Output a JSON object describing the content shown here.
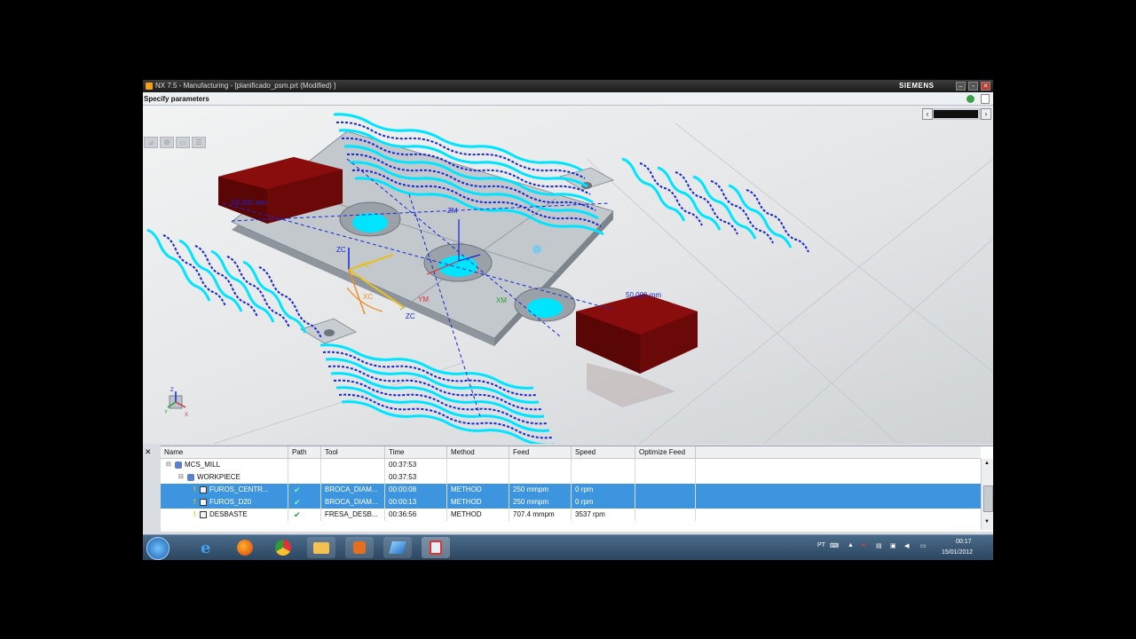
{
  "window": {
    "title": "NX 7.5 - Manufacturing - [planificado_psm.prt (Modified) ]",
    "brand": "SIEMENS",
    "controls": {
      "minimize": "–",
      "restore": "▫",
      "close": "✕"
    }
  },
  "cue_line": "Specify parameters",
  "viewport": {
    "labels": {
      "zc1": "ZC",
      "zm": "ZM",
      "yc": "YC",
      "xc": "XC",
      "ym": "YM",
      "xm": "XM",
      "zc2": "ZC",
      "dim1": "50.000 mm",
      "dim2": "50.000 mm"
    },
    "triad": {
      "z": "Z",
      "y": "Y",
      "x": "X"
    }
  },
  "navigator": {
    "columns": [
      "Name",
      "Path",
      "Tool",
      "Time",
      "Method",
      "Feed",
      "Speed",
      "Optimize Feed"
    ],
    "rows": [
      {
        "name": "MCS_MILL",
        "path": "",
        "tool": "",
        "time": "00:37:53",
        "method": "",
        "feed": "",
        "speed": "",
        "selected": false,
        "level": 0,
        "icon": "mcs-icon"
      },
      {
        "name": "WORKPIECE",
        "path": "",
        "tool": "",
        "time": "00:37:53",
        "method": "",
        "feed": "",
        "speed": "",
        "selected": false,
        "level": 1,
        "icon": "workpiece-icon"
      },
      {
        "name": "FUROS_CENTR...",
        "path": "✔",
        "tool": "BROCA_DIAM...",
        "time": "00:00:08",
        "method": "METHOD",
        "feed": "250 mmpm",
        "speed": "0 rpm",
        "selected": true,
        "level": 2,
        "icon": "drill-operation-icon"
      },
      {
        "name": "FUROS_D20",
        "path": "✔",
        "tool": "BROCA_DIAM...",
        "time": "00:00:13",
        "method": "METHOD",
        "feed": "250 mmpm",
        "speed": "0 rpm",
        "selected": true,
        "level": 2,
        "icon": "drill-operation-icon"
      },
      {
        "name": "DESBASTE",
        "path": "✔",
        "tool": "FRESA_DESB...",
        "time": "00:36:56",
        "method": "METHOD",
        "feed": "707.4 mmpm",
        "speed": "3537 rpm",
        "selected": false,
        "level": 2,
        "icon": "cavity-mill-icon"
      }
    ]
  },
  "taskbar": {
    "language": "PT",
    "time": "00:17",
    "date": "15/01/2012",
    "apps": [
      "start-orb-icon",
      "internet-explorer-icon",
      "firefox-icon",
      "chrome-icon",
      "explorer-folder-icon",
      "media-player-icon",
      "app-icon",
      "nx-app-icon"
    ]
  },
  "colors": {
    "toolpath_cyan": "#00e5ff",
    "toolpath_blue": "#1526d6",
    "selection": "#3d95e0",
    "block_red": "#8a0d0d"
  }
}
